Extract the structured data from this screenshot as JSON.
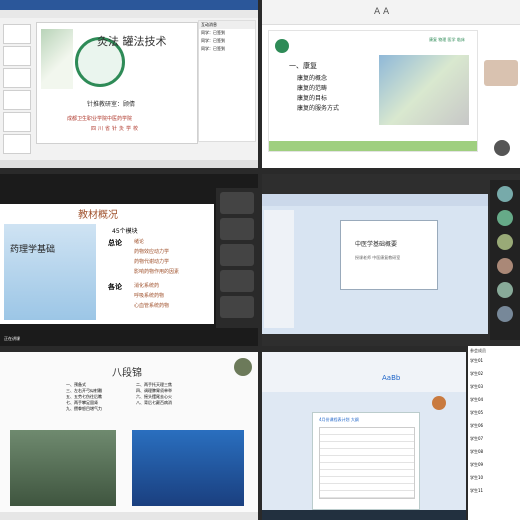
{
  "q1": {
    "ppt_title": "灸法 罐法技术",
    "teacher": "针推教研室：顾倩",
    "school_line1": "成都卫生职业学院中医药学院",
    "school_line2": "四川省针灸学校",
    "chat_header": "互动消息",
    "chat_rows": [
      "同学：已签到",
      "同学：已签到",
      "同学：已签到"
    ]
  },
  "q2": {
    "menu_title": "一、康复",
    "items": [
      "康复的概念",
      "康复的范畴",
      "康复的目标",
      "康复的服务方式"
    ],
    "logo_text": "康复 物理 医学 临床"
  },
  "q3": {
    "section_title": "教材概况",
    "book_title": "药理学基础",
    "modules_line": "45个模块",
    "total_label": "总论",
    "total_items": [
      "绪论",
      "药物效应动力学",
      "药物代谢动力学",
      "影响药物作用的因素"
    ],
    "sub_label": "各论",
    "sub_items": [
      "消化系统药",
      "呼吸系统药物",
      "心血管系统药物"
    ],
    "status_text": "正在讲课"
  },
  "q4": {
    "slide_title": "中医学基础概要",
    "slide_sub": "授课老师  中医康复教研室"
  },
  "q5": {
    "title": "八段锦",
    "left_col": [
      "一、预备式",
      "三、左右开弓似射雕",
      "五、五劳七伤往后瞧",
      "七、两手攀足固肾",
      "九、攒拳怒目增气力"
    ],
    "right_col": [
      "二、两手托天理三焦",
      "四、调理脾胃须单举",
      "六、摇头摆尾去心火",
      "八、背后七颠百病消",
      ""
    ]
  },
  "q6": {
    "doc_title": "4月份课程表计划 大纲",
    "paste_label": "AaBb",
    "zoom_text": "100%"
  },
  "q8": {
    "list_title": "参会成员",
    "members": [
      "学生01",
      "学生02",
      "学生03",
      "学生04",
      "学生05",
      "学生06",
      "学生07",
      "学生08",
      "学生09",
      "学生10",
      "学生11",
      "学生12"
    ]
  },
  "colors": {
    "accent_blue": "#1e64c8",
    "green_logo": "#2e8b57",
    "red_title": "#c0392b",
    "gold_title": "#a0522d"
  }
}
